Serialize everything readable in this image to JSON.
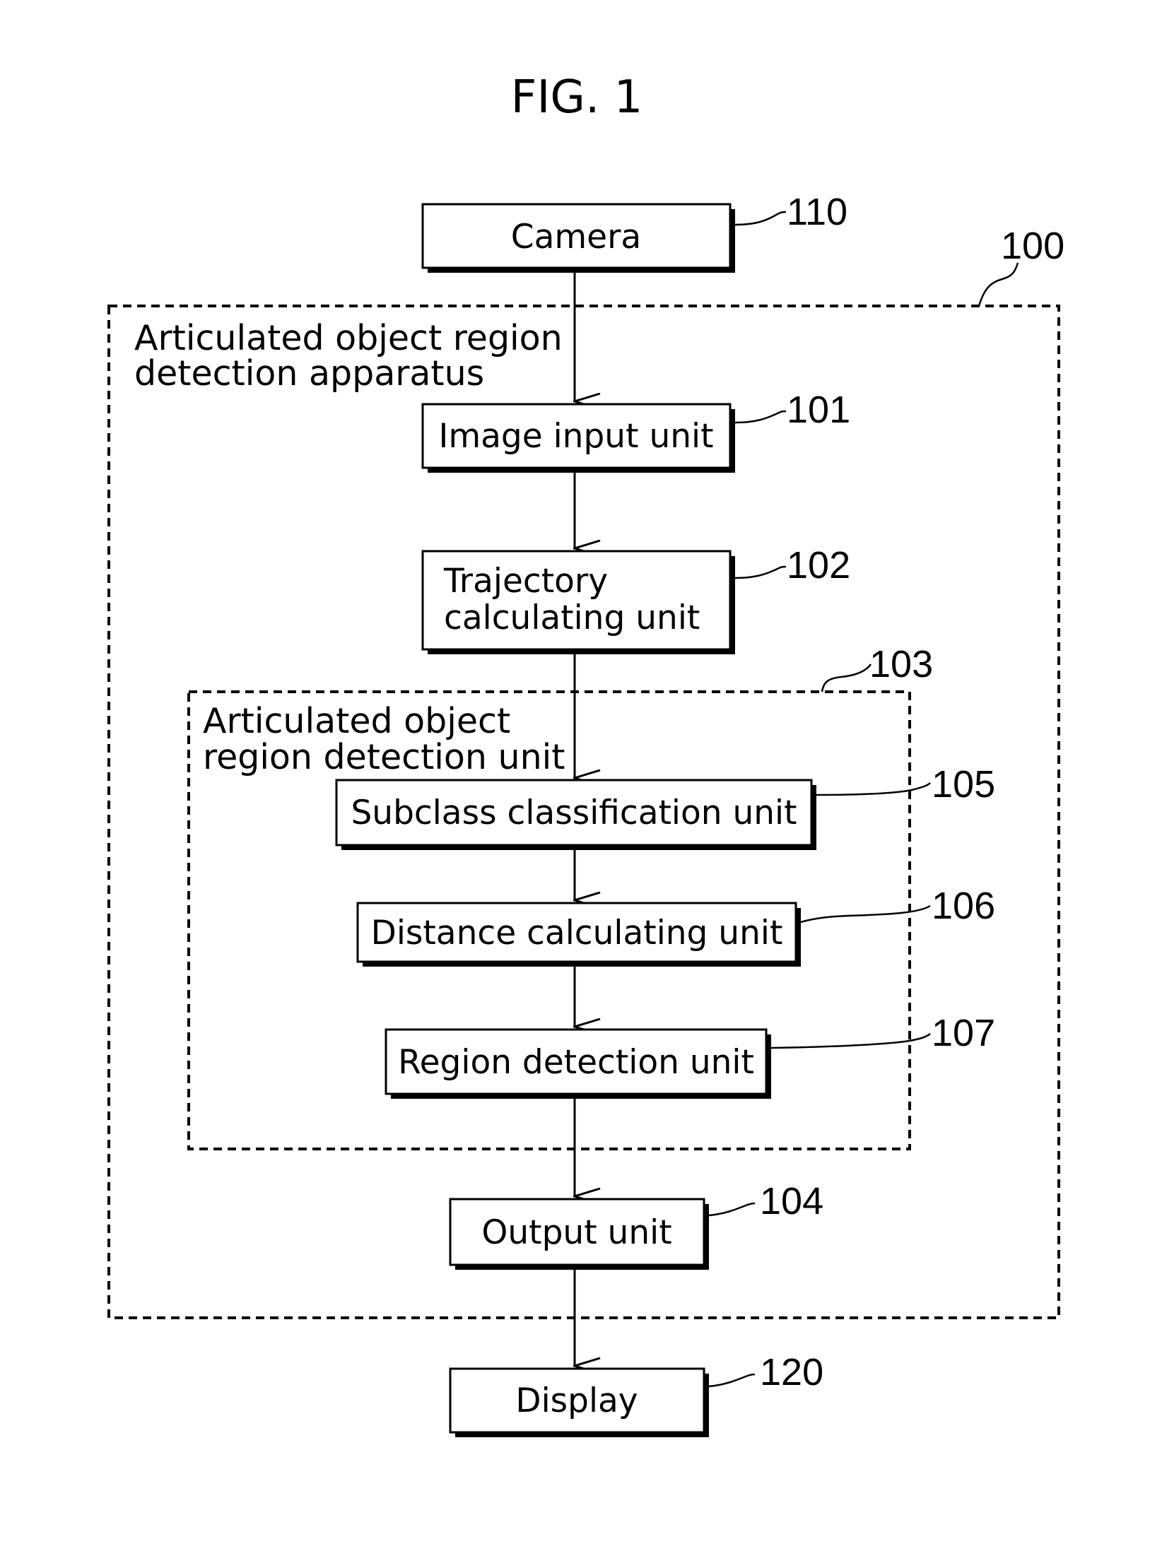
{
  "figure": {
    "title": "FIG. 1"
  },
  "blocks": {
    "camera": {
      "label": "Camera",
      "ref": "110"
    },
    "image_input_unit": {
      "label": "Image input unit",
      "ref": "101"
    },
    "trajectory_calculating_unit": {
      "label_lines": [
        "Trajectory",
        "calculating unit"
      ],
      "ref": "102"
    },
    "subclass_classification_unit": {
      "label": "Subclass classification unit",
      "ref": "105"
    },
    "distance_calculating_unit": {
      "label": "Distance calculating unit",
      "ref": "106"
    },
    "region_detection_unit": {
      "label": "Region detection unit",
      "ref": "107"
    },
    "output_unit": {
      "label": "Output unit",
      "ref": "104"
    },
    "display": {
      "label": "Display",
      "ref": "120"
    }
  },
  "groups": {
    "apparatus": {
      "label_lines": [
        "Articulated object region",
        "detection apparatus"
      ],
      "ref": "100"
    },
    "detection_unit": {
      "label_lines": [
        "Articulated object",
        "region detection unit"
      ],
      "ref": "103"
    }
  },
  "flow": [
    "Camera",
    "Image input unit",
    "Trajectory calculating unit",
    "Subclass classification unit",
    "Distance calculating unit",
    "Region detection unit",
    "Output unit",
    "Display"
  ]
}
